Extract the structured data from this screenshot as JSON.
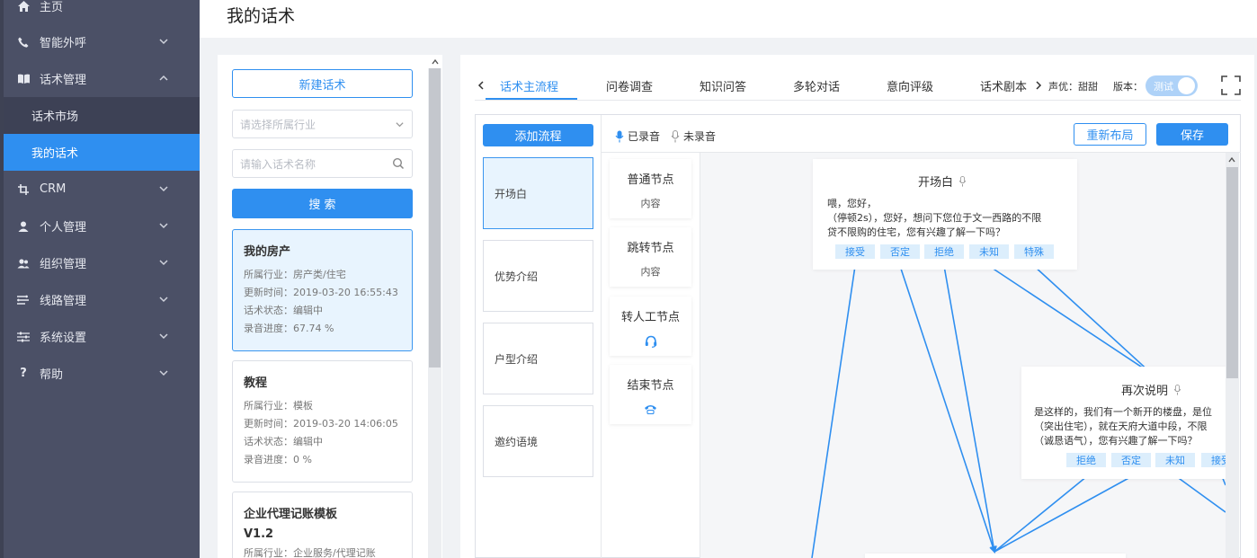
{
  "sidebar": {
    "items": [
      {
        "label": "主页",
        "icon": "home-icon"
      },
      {
        "label": "智能外呼",
        "icon": "phone-icon"
      },
      {
        "label": "话术管理",
        "icon": "book-icon"
      },
      {
        "label": "CRM",
        "icon": "crop-icon"
      },
      {
        "label": "个人管理",
        "icon": "user-icon"
      },
      {
        "label": "组织管理",
        "icon": "group-icon"
      },
      {
        "label": "线路管理",
        "icon": "route-icon"
      },
      {
        "label": "系统设置",
        "icon": "sliders-icon"
      },
      {
        "label": "帮助",
        "icon": "help-icon"
      }
    ],
    "submenu": [
      {
        "label": "话术市场"
      },
      {
        "label": "我的话术",
        "active": true
      }
    ]
  },
  "page": {
    "title": "我的话术"
  },
  "left_panel": {
    "new_button": "新建话术",
    "industry_placeholder": "请选择所属行业",
    "name_placeholder": "请输入话术名称",
    "search_button": "搜 索",
    "cards": [
      {
        "title": "我的房产",
        "industry": "所属行业：房产类/住宅",
        "updated": "更新时间：2019-03-20 16:55:43",
        "status": "话术状态：编辑中",
        "progress": "录音进度：67.74 %"
      },
      {
        "title": "教程",
        "industry": "所属行业：模板",
        "updated": "更新时间：2019-03-20 14:06:05",
        "status": "话术状态：编辑中",
        "progress": "录音进度：0 %"
      },
      {
        "title": "企业代理记账模板",
        "title2": "V1.2",
        "industry": "所属行业：企业服务/代理记账"
      }
    ]
  },
  "main": {
    "tabs": [
      "话术主流程",
      "问卷调查",
      "知识问答",
      "多轮对话",
      "意向评级",
      "话术剧本"
    ],
    "voice": "声优：甜甜",
    "version_label": "版本：",
    "version_toggle": "测试",
    "add_flow_button": "添加流程",
    "recorded": "已录音",
    "not_recorded": "未录音",
    "relayout_button": "重新布局",
    "save_button": "保存",
    "flows": [
      "开场白",
      "优势介绍",
      "户型介绍",
      "邀约语境"
    ],
    "node_types": [
      {
        "title": "普通节点",
        "sub": "内容"
      },
      {
        "title": "跳转节点",
        "sub": "内容"
      },
      {
        "title": "转人工节点",
        "icon": "headset-icon"
      },
      {
        "title": "结束节点",
        "icon": "phone-hangup-icon"
      }
    ],
    "canvas": {
      "node1": {
        "title": "开场白",
        "lines": [
          "喂，您好，",
          "（停顿2s），您好，想问下您位于文一西路的不限",
          "贷不限购的住宅，您有兴趣了解一下吗？"
        ],
        "branches": [
          "接受",
          "否定",
          "拒绝",
          "未知",
          "特殊"
        ]
      },
      "node2": {
        "title": "再次说明",
        "lines": [
          "是这样的，我们有一个新开的楼盘，是位",
          "（突出住宅），就在天府大道中段，不限",
          "（诚恳语气），您有兴趣了解一下吗？"
        ],
        "branches": [
          "拒绝",
          "否定",
          "未知",
          "接受"
        ]
      }
    },
    "colors": {
      "accent": "#2f8ff0",
      "sidebar": "#4b5066",
      "selected_bg": "#e8f4fe"
    }
  }
}
